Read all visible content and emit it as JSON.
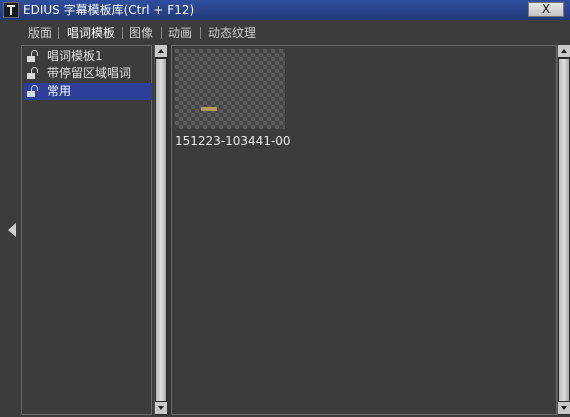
{
  "window": {
    "title": "EDIUS 字幕模板库(Ctrl + F12)",
    "close_label": "X"
  },
  "tabs": [
    {
      "label": "版面"
    },
    {
      "label": "唱词模板"
    },
    {
      "label": "图像"
    },
    {
      "label": "动画"
    },
    {
      "label": "动态纹理"
    }
  ],
  "active_tab": "唱词模板",
  "tree": {
    "items": [
      {
        "label": "唱词模板1",
        "icon": "lock-open-icon",
        "selected": false
      },
      {
        "label": "带停留区域唱词",
        "icon": "lock-open-icon",
        "selected": false
      },
      {
        "label": "常用",
        "icon": "lock-open-icon",
        "selected": true
      }
    ]
  },
  "templates": [
    {
      "name": "151223-103441-00",
      "thumbnail": "checkerboard-transparent"
    }
  ],
  "colors": {
    "titlebar": "#2a4590",
    "selection": "#2e3f9a",
    "background": "#3c3c3c"
  }
}
